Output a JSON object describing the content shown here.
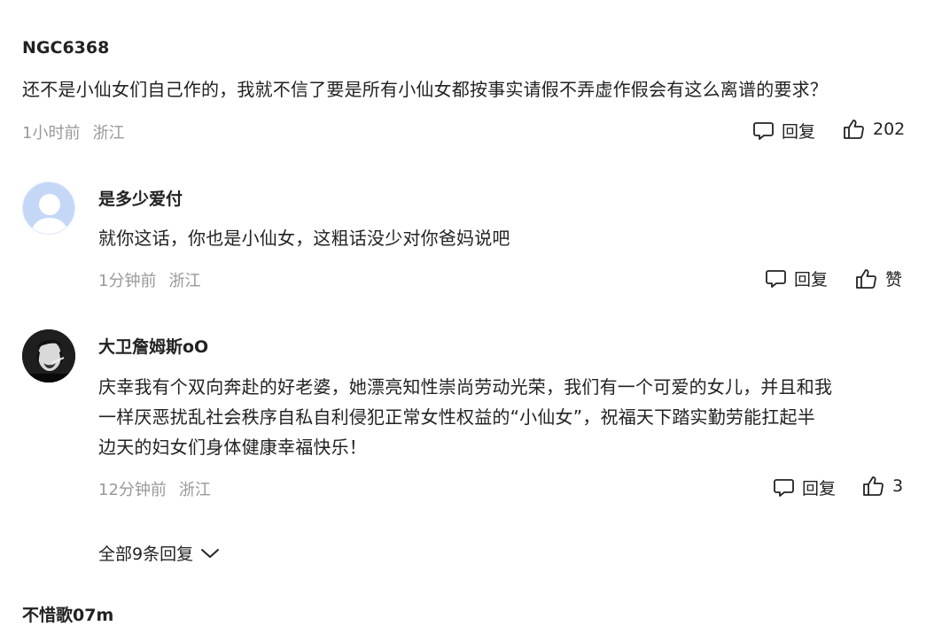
{
  "main_comment": {
    "username": "NGC6368",
    "text": "还不是小仙女们自己作的，我就不信了要是所有小仙女都按事实请假不弄虚作假会有这么离谱的要求？",
    "time": "1小时前",
    "location": "浙江",
    "reply_label": "回复",
    "like_count": "202"
  },
  "replies": [
    {
      "username": "是多少爱付",
      "text": "就你这话，你也是小仙女，这粗话没少对你爸妈说吧",
      "time": "1分钟前",
      "location": "浙江",
      "reply_label": "回复",
      "like_label": "赞"
    },
    {
      "username": "大卫詹姆斯oO",
      "text_lines": [
        "庆幸我有个双向奔赴的好老婆，她漂亮知性崇尚劳动光荣，我们有一个可爱的女儿，并且和我",
        "一样厌恶扰乱社会秩序自私自利侵犯正常女性权益的“小仙女”，祝福天下踏实勤劳能扛起半",
        "边天的妇女们身体健康幸福快乐！"
      ],
      "time": "12分钟前",
      "location": "浙江",
      "reply_label": "回复",
      "like_count": "3"
    }
  ],
  "expand_replies_label": "全部9条回复",
  "next_comment_username": "不惜歌07m",
  "icons": {
    "reply": "comment-bubble-icon",
    "like": "thumbs-up-icon",
    "expand": "chevron-down-icon",
    "avatar_default": "default-avatar-icon"
  },
  "colors": {
    "text": "#222222",
    "meta": "#999999",
    "avatar_default": "#c5d7f7"
  }
}
